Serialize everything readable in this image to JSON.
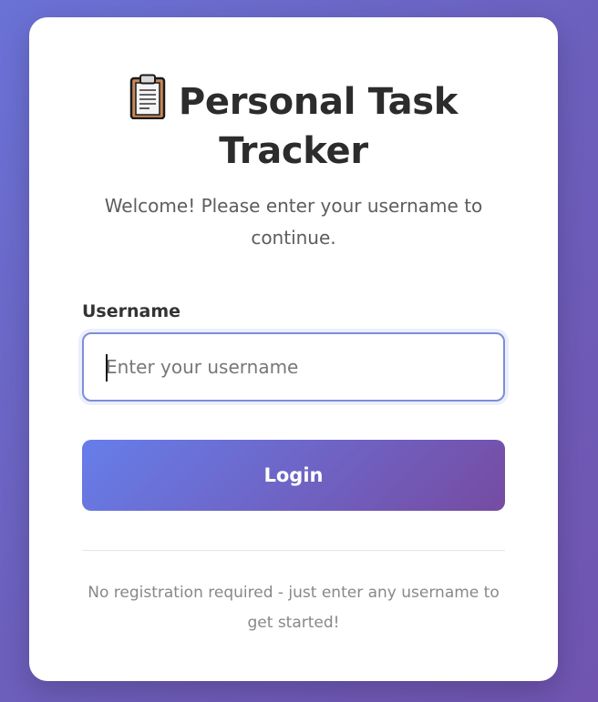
{
  "app": {
    "title": "Personal Task Tracker",
    "icon": "clipboard-icon"
  },
  "login": {
    "subtitle": "Welcome! Please enter your username to continue.",
    "username_label": "Username",
    "username_placeholder": "Enter your username",
    "username_value": "",
    "submit_label": "Login",
    "footer_note": "No registration required - just enter any username to get started!"
  },
  "colors": {
    "background_start": "#667eea",
    "background_end": "#764ba2",
    "button_gradient_start": "#667eea",
    "button_gradient_end": "#764ba2",
    "input_focus_border": "#7d8ed8",
    "card": "#ffffff",
    "title_text": "#2c2c2c"
  }
}
